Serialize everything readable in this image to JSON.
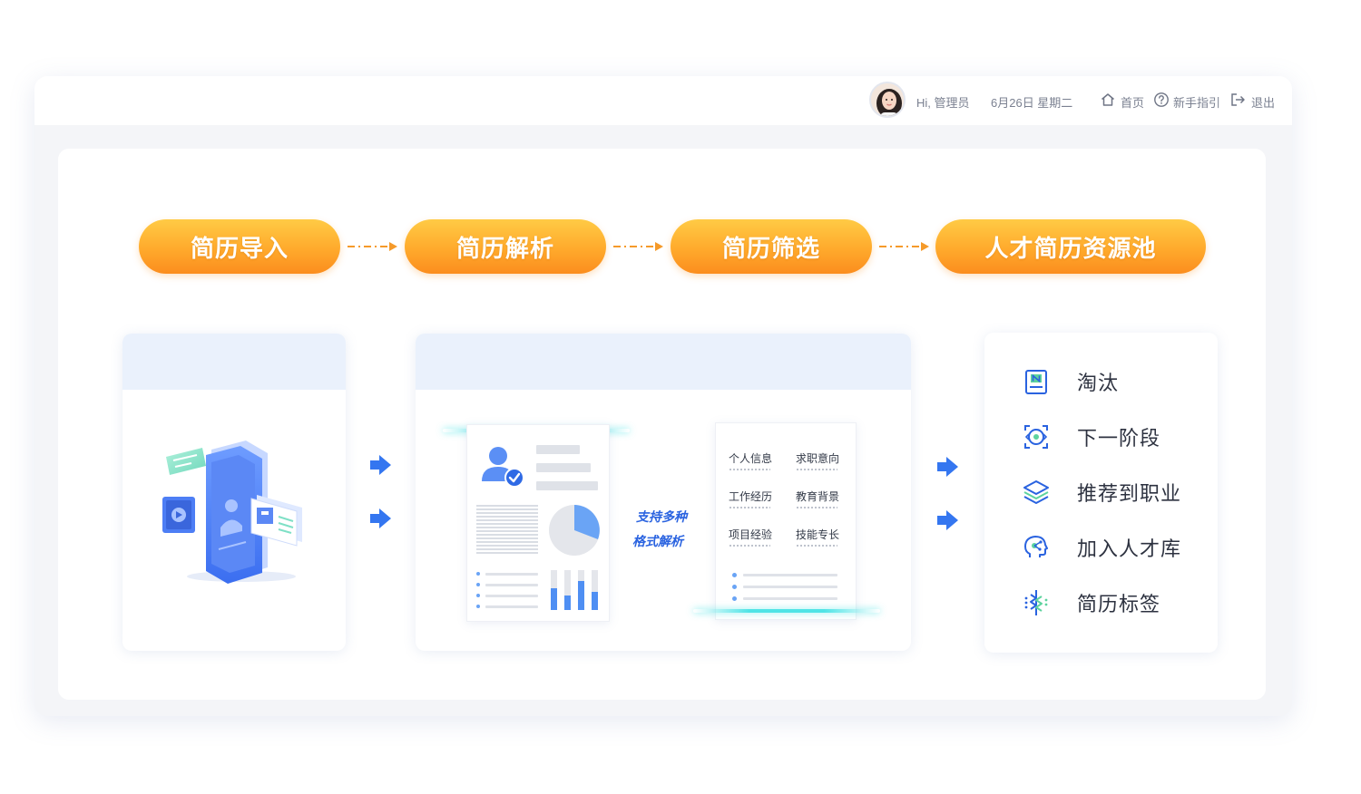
{
  "header": {
    "greeting": "Hi, 管理员",
    "date": "6月26日 星期二",
    "nav": {
      "home_label": "首页",
      "guide_label": "新手指引",
      "logout_label": "退出"
    }
  },
  "flow": {
    "steps": [
      "简历导入",
      "简历解析",
      "简历筛选",
      "人才简历资源池"
    ],
    "accent_color": "#ffaa2c"
  },
  "parse_card": {
    "support_line1": "支持多种",
    "support_line2": "格式解析",
    "fields": [
      "个人信息",
      "求职意向",
      "工作经历",
      "教育背景",
      "项目经验",
      "技能专长"
    ]
  },
  "actions": [
    {
      "label": "淘汰",
      "icon": "note-n-icon"
    },
    {
      "label": "下一阶段",
      "icon": "target-icon"
    },
    {
      "label": "推荐到职业",
      "icon": "layers-icon"
    },
    {
      "label": "加入人才库",
      "icon": "brain-head-icon"
    },
    {
      "label": "简历标签",
      "icon": "dna-icon"
    }
  ]
}
